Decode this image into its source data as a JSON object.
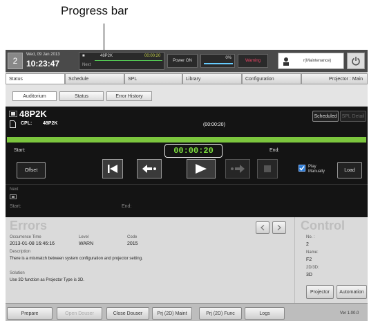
{
  "callout": {
    "label": "Progress bar"
  },
  "topbar": {
    "screen_number": "2",
    "date": "Wed, 09 Jan 2013",
    "time": "10:23:47",
    "now_prefix": "■",
    "now_title": "48P2K",
    "now_time": "00:00:20",
    "next_label": "Next",
    "power_label": "Power ON",
    "percent_label": "0%",
    "warning_label": "Warning",
    "user_label": "r(Maintenance)"
  },
  "tabs": {
    "status": "Status",
    "schedule": "Schedule",
    "spl": "SPL",
    "library": "Library",
    "configuration": "Configuration",
    "projector": "Projector : Main"
  },
  "subtabs": {
    "auditorium": "Auditorium",
    "status": "Status",
    "error_history": "Error History"
  },
  "playback": {
    "title": "48P2K",
    "cpl_label": "CPL:",
    "cpl_value": "48P2K",
    "duration": "(00:00:20)",
    "start_label": "Start:",
    "end_label": "End:",
    "timecode": "00:00:20",
    "scheduled_label": "Scheduled",
    "spl_detail_label": "SPL Detail",
    "offset_label": "Offset",
    "play_manually_label": "Play\nManually",
    "load_label": "Load",
    "progress": 1.0
  },
  "next": {
    "label": "Next",
    "start_label": "Start:",
    "end_label": "End:"
  },
  "errors": {
    "heading": "Errors",
    "col_time": "Occurrence Time",
    "col_level": "Level",
    "col_code": "Code",
    "time": "2013-01-08 16:46:16",
    "level": "WARN",
    "code": "2015",
    "description_label": "Description",
    "description": "There is a mismatch between system configuration and projector setting.",
    "solution_label": "Solution",
    "solution": "Use 3D function as Projector Type is 3D."
  },
  "control": {
    "heading": "Control",
    "no_label": "No. :",
    "no_value": "2",
    "name_label": "Name:",
    "name_value": "F2",
    "mode_label": "2D/3D:",
    "mode_value": "3D",
    "projector_button": "Projector",
    "automation_button": "Automation"
  },
  "bottom": {
    "prepare": "Prepare",
    "open_douser": "Open Douser",
    "close_douser": "Close Douser",
    "prj_maint": "Prj (2D) Maint",
    "prj_func": "Prj (2D) Func",
    "logs": "Logs",
    "version": "Ver 1.00.0"
  }
}
